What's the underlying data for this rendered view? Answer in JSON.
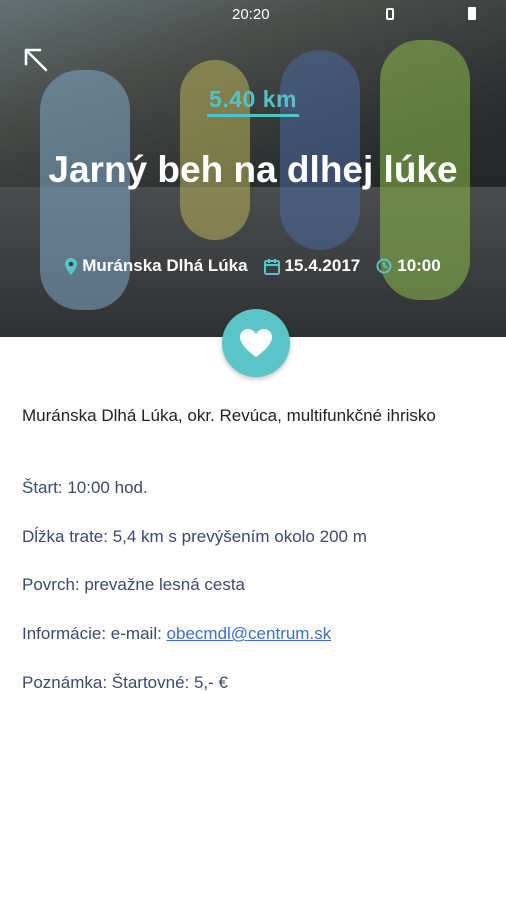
{
  "status": {
    "time": "20:20"
  },
  "event": {
    "distance": "5.40 km",
    "title": "Jarný beh na dlhej lúke",
    "location": "Muránska Dlhá Lúka",
    "date": "15.4.2017",
    "time": "10:00"
  },
  "details": {
    "place": "Muránska Dlhá Lúka, okr. Revúca, multifunkčné ihrisko",
    "start": "Štart: 10:00 hod.",
    "length": "Dĺžka trate: 5,4 km s prevýšením okolo 200 m",
    "surface": "Povrch: prevažne lesná cesta",
    "info_label": "Informácie: e-mail: ",
    "info_email": "obecmdl@centrum.sk",
    "note": "Poznámka: Štartovné: 5,- €"
  },
  "colors": {
    "accent": "#5ac4c6",
    "link": "#3b6fd1",
    "text": "#3b4a6b"
  },
  "icons": [
    "back-arrow-icon",
    "map-pin-icon",
    "calendar-icon",
    "clock-icon",
    "heart-icon"
  ]
}
